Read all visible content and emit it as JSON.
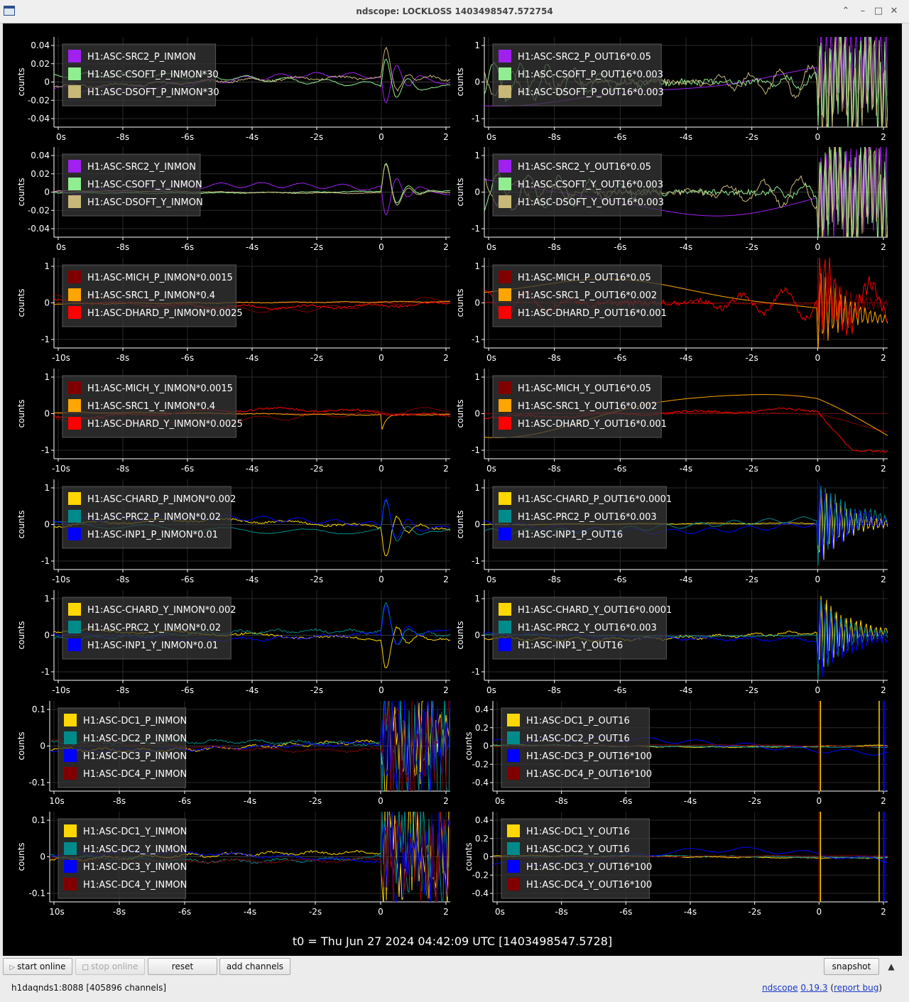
{
  "window": {
    "title": "ndscope: LOCKLOSS 1403498547.572754",
    "controls": [
      "⌃",
      "–",
      "□",
      "✕"
    ]
  },
  "t0_label": "t0 = Thu Jun 27 2024 04:42:09 UTC [1403498547.5728]",
  "toolbar": {
    "start_online": "start online",
    "stop_online": "stop online",
    "reset": "reset",
    "add_channels": "add channels",
    "snapshot": "snapshot",
    "status": "h1daqnds1:8088  [405896 channels]",
    "ndscope_link": "ndscope",
    "version_link": "0.19.3",
    "report_bug_link": "report bug"
  },
  "colors": {
    "purple": "#a020f0",
    "lightgreen": "#90ee90",
    "khaki": "#c8b878",
    "darkred": "#800000",
    "orange": "#ffa500",
    "red": "#ff0000",
    "gold": "#ffd700",
    "teal": "#008b8b",
    "blue": "#0000ff",
    "grid": "#2a2a2a",
    "axis": "#ffffff"
  },
  "chart_data": [
    {
      "type": "line",
      "ylabel": "counts",
      "yticks": [
        "0.04",
        "0.02",
        "0",
        "-0.02",
        "-0.04"
      ],
      "xticks": [
        "0s",
        "-8s",
        "-6s",
        "-4s",
        "-2s",
        "0",
        "2"
      ],
      "legend": [
        "H1:ASC-SRC2_P_INMON",
        "H1:ASC-CSOFT_P_INMON*30",
        "H1:ASC-DSOFT_P_INMON*30"
      ],
      "colors": [
        "purple",
        "lightgreen",
        "khaki"
      ],
      "style": [
        "smooth",
        "smooth",
        "wavy"
      ],
      "event": "kick"
    },
    {
      "type": "line",
      "ylabel": "counts",
      "yticks": [
        "1",
        "0",
        "-1"
      ],
      "xticks": [
        "0s",
        "-8s",
        "-6s",
        "-4s",
        "-2s",
        "0",
        "2"
      ],
      "legend": [
        "H1:ASC-SRC2_P_OUT16*0.05",
        "H1:ASC-CSOFT_P_OUT16*0.003",
        "H1:ASC-DSOFT_P_OUT16*0.003"
      ],
      "colors": [
        "purple",
        "lightgreen",
        "khaki"
      ],
      "style": [
        "drift",
        "noisy",
        "noisy"
      ],
      "event": "burst"
    },
    {
      "type": "line",
      "ylabel": "counts",
      "yticks": [
        "0.04",
        "0.02",
        "0",
        "-0.02",
        "-0.04"
      ],
      "xticks": [
        "0s",
        "-8s",
        "-6s",
        "-4s",
        "-2s",
        "0",
        "2"
      ],
      "legend": [
        "H1:ASC-SRC2_Y_INMON",
        "H1:ASC-CSOFT_Y_INMON",
        "H1:ASC-DSOFT_Y_INMON"
      ],
      "colors": [
        "purple",
        "lightgreen",
        "khaki"
      ],
      "style": [
        "smooth",
        "flat",
        "flat"
      ],
      "event": "kick"
    },
    {
      "type": "line",
      "ylabel": "counts",
      "yticks": [
        "1",
        "0",
        "-1"
      ],
      "xticks": [
        "0s",
        "-8s",
        "-6s",
        "-4s",
        "-2s",
        "0",
        "2"
      ],
      "legend": [
        "H1:ASC-SRC2_Y_OUT16*0.05",
        "H1:ASC-CSOFT_Y_OUT16*0.003",
        "H1:ASC-DSOFT_Y_OUT16*0.003"
      ],
      "colors": [
        "purple",
        "lightgreen",
        "khaki"
      ],
      "style": [
        "drift",
        "noisy",
        "noisy"
      ],
      "event": "burst"
    },
    {
      "type": "line",
      "ylabel": "counts",
      "yticks": [
        "1",
        "0",
        "-1"
      ],
      "xticks": [
        "-10s",
        "-8s",
        "-6s",
        "-4s",
        "-2s",
        "0",
        "2"
      ],
      "legend": [
        "H1:ASC-MICH_P_INMON*0.0015",
        "H1:ASC-SRC1_P_INMON*0.4",
        "H1:ASC-DHARD_P_INMON*0.0025"
      ],
      "colors": [
        "darkred",
        "orange",
        "red"
      ],
      "style": [
        "smooth",
        "flat",
        "wavy"
      ],
      "event": "none"
    },
    {
      "type": "line",
      "ylabel": "counts",
      "yticks": [
        "1",
        "0",
        "-1"
      ],
      "xticks": [
        "0s",
        "-8s",
        "-6s",
        "-4s",
        "-2s",
        "0",
        "2"
      ],
      "legend": [
        "H1:ASC-MICH_P_OUT16*0.05",
        "H1:ASC-SRC1_P_OUT16*0.002",
        "H1:ASC-DHARD_P_OUT16*0.001"
      ],
      "colors": [
        "darkred",
        "orange",
        "red"
      ],
      "style": [
        "flat",
        "drift",
        "noisy"
      ],
      "event": "ring"
    },
    {
      "type": "line",
      "ylabel": "counts",
      "yticks": [
        "1",
        "0",
        "-1"
      ],
      "xticks": [
        "-10s",
        "-8s",
        "-6s",
        "-4s",
        "-2s",
        "0",
        "2"
      ],
      "legend": [
        "H1:ASC-MICH_Y_INMON*0.0015",
        "H1:ASC-SRC1_Y_INMON*0.4",
        "H1:ASC-DHARD_Y_INMON*0.0025"
      ],
      "colors": [
        "darkred",
        "orange",
        "red"
      ],
      "style": [
        "smooth",
        "flat",
        "wavy"
      ],
      "event": "dip"
    },
    {
      "type": "line",
      "ylabel": "counts",
      "yticks": [
        "1",
        "0",
        "-1"
      ],
      "xticks": [
        "0s",
        "-8s",
        "-6s",
        "-4s",
        "-2s",
        "0",
        "2"
      ],
      "legend": [
        "H1:ASC-MICH_Y_OUT16*0.05",
        "H1:ASC-SRC1_Y_OUT16*0.002",
        "H1:ASC-DHARD_Y_OUT16*0.001"
      ],
      "colors": [
        "darkred",
        "orange",
        "red"
      ],
      "style": [
        "flat",
        "drift",
        "wavy"
      ],
      "event": "drop"
    },
    {
      "type": "line",
      "ylabel": "counts",
      "yticks": [
        "1",
        "0",
        "-1"
      ],
      "xticks": [
        "-10s",
        "-8s",
        "-6s",
        "-4s",
        "-2s",
        "0",
        "2"
      ],
      "legend": [
        "H1:ASC-CHARD_P_INMON*0.002",
        "H1:ASC-PRC2_P_INMON*0.02",
        "H1:ASC-INP1_P_INMON*0.01"
      ],
      "colors": [
        "gold",
        "teal",
        "blue"
      ],
      "style": [
        "wavy",
        "smooth",
        "smooth"
      ],
      "event": "kick"
    },
    {
      "type": "line",
      "ylabel": "counts",
      "yticks": [
        "1",
        "0",
        "-1"
      ],
      "xticks": [
        "0s",
        "-8s",
        "-6s",
        "-4s",
        "-2s",
        "0",
        "2"
      ],
      "legend": [
        "H1:ASC-CHARD_P_OUT16*0.0001",
        "H1:ASC-PRC2_P_OUT16*0.003",
        "H1:ASC-INP1_P_OUT16"
      ],
      "colors": [
        "gold",
        "teal",
        "blue"
      ],
      "style": [
        "flat",
        "smooth",
        "smooth"
      ],
      "event": "ring"
    },
    {
      "type": "line",
      "ylabel": "counts",
      "yticks": [
        "1",
        "0",
        "-1"
      ],
      "xticks": [
        "-10s",
        "-8s",
        "-6s",
        "-4s",
        "-2s",
        "0",
        "2"
      ],
      "legend": [
        "H1:ASC-CHARD_Y_INMON*0.002",
        "H1:ASC-PRC2_Y_INMON*0.02",
        "H1:ASC-INP1_Y_INMON*0.01"
      ],
      "colors": [
        "gold",
        "teal",
        "blue"
      ],
      "style": [
        "wavy",
        "wavy",
        "wavy"
      ],
      "event": "kick"
    },
    {
      "type": "line",
      "ylabel": "counts",
      "yticks": [
        "1",
        "0",
        "-1"
      ],
      "xticks": [
        "0s",
        "-8s",
        "-6s",
        "-4s",
        "-2s",
        "0",
        "2"
      ],
      "legend": [
        "H1:ASC-CHARD_Y_OUT16*0.0001",
        "H1:ASC-PRC2_Y_OUT16*0.003",
        "H1:ASC-INP1_Y_OUT16"
      ],
      "colors": [
        "gold",
        "teal",
        "blue"
      ],
      "style": [
        "wavy",
        "flat",
        "wavy"
      ],
      "event": "ring"
    },
    {
      "type": "line",
      "ylabel": "counts",
      "yticks": [
        "0.1",
        "0",
        "-0.1"
      ],
      "xticks": [
        "10s",
        "-8s",
        "-6s",
        "-4s",
        "-2s",
        "0",
        "2"
      ],
      "legend": [
        "H1:ASC-DC1_P_INMON",
        "H1:ASC-DC2_P_INMON",
        "H1:ASC-DC3_P_INMON",
        "H1:ASC-DC4_P_INMON"
      ],
      "colors": [
        "gold",
        "teal",
        "blue",
        "darkred"
      ],
      "style": [
        "wavy",
        "wavy",
        "wavy",
        "wavy"
      ],
      "event": "chaos"
    },
    {
      "type": "line",
      "ylabel": "counts",
      "yticks": [
        "0.4",
        "0.2",
        "0",
        "-0.2",
        "-0.4"
      ],
      "xticks": [
        "0s",
        "-8s",
        "-6s",
        "-4s",
        "-2s",
        "0",
        "2"
      ],
      "legend": [
        "H1:ASC-DC1_P_OUT16",
        "H1:ASC-DC2_P_OUT16",
        "H1:ASC-DC3_P_OUT16*100",
        "H1:ASC-DC4_P_OUT16*100"
      ],
      "colors": [
        "gold",
        "teal",
        "blue",
        "darkred"
      ],
      "style": [
        "flat",
        "flat",
        "smooth",
        "flat"
      ],
      "event": "spikes"
    },
    {
      "type": "line",
      "ylabel": "counts",
      "yticks": [
        "0.1",
        "0",
        "-0.1"
      ],
      "xticks": [
        "10s",
        "-8s",
        "-6s",
        "-4s",
        "-2s",
        "0",
        "2"
      ],
      "legend": [
        "H1:ASC-DC1_Y_INMON",
        "H1:ASC-DC2_Y_INMON",
        "H1:ASC-DC3_Y_INMON",
        "H1:ASC-DC4_Y_INMON"
      ],
      "colors": [
        "gold",
        "teal",
        "blue",
        "darkred"
      ],
      "style": [
        "wavy",
        "wavy",
        "wavy",
        "wavy"
      ],
      "event": "chaos"
    },
    {
      "type": "line",
      "ylabel": "counts",
      "yticks": [
        "0.4",
        "0.2",
        "0",
        "-0.2",
        "-0.4"
      ],
      "xticks": [
        "0s",
        "-8s",
        "-6s",
        "-4s",
        "-2s",
        "0",
        "2"
      ],
      "legend": [
        "H1:ASC-DC1_Y_OUT16",
        "H1:ASC-DC2_Y_OUT16",
        "H1:ASC-DC3_Y_OUT16*100",
        "H1:ASC-DC4_Y_OUT16*100"
      ],
      "colors": [
        "gold",
        "teal",
        "blue",
        "darkred"
      ],
      "style": [
        "flat",
        "flat",
        "smooth",
        "flat"
      ],
      "event": "spikes"
    }
  ]
}
